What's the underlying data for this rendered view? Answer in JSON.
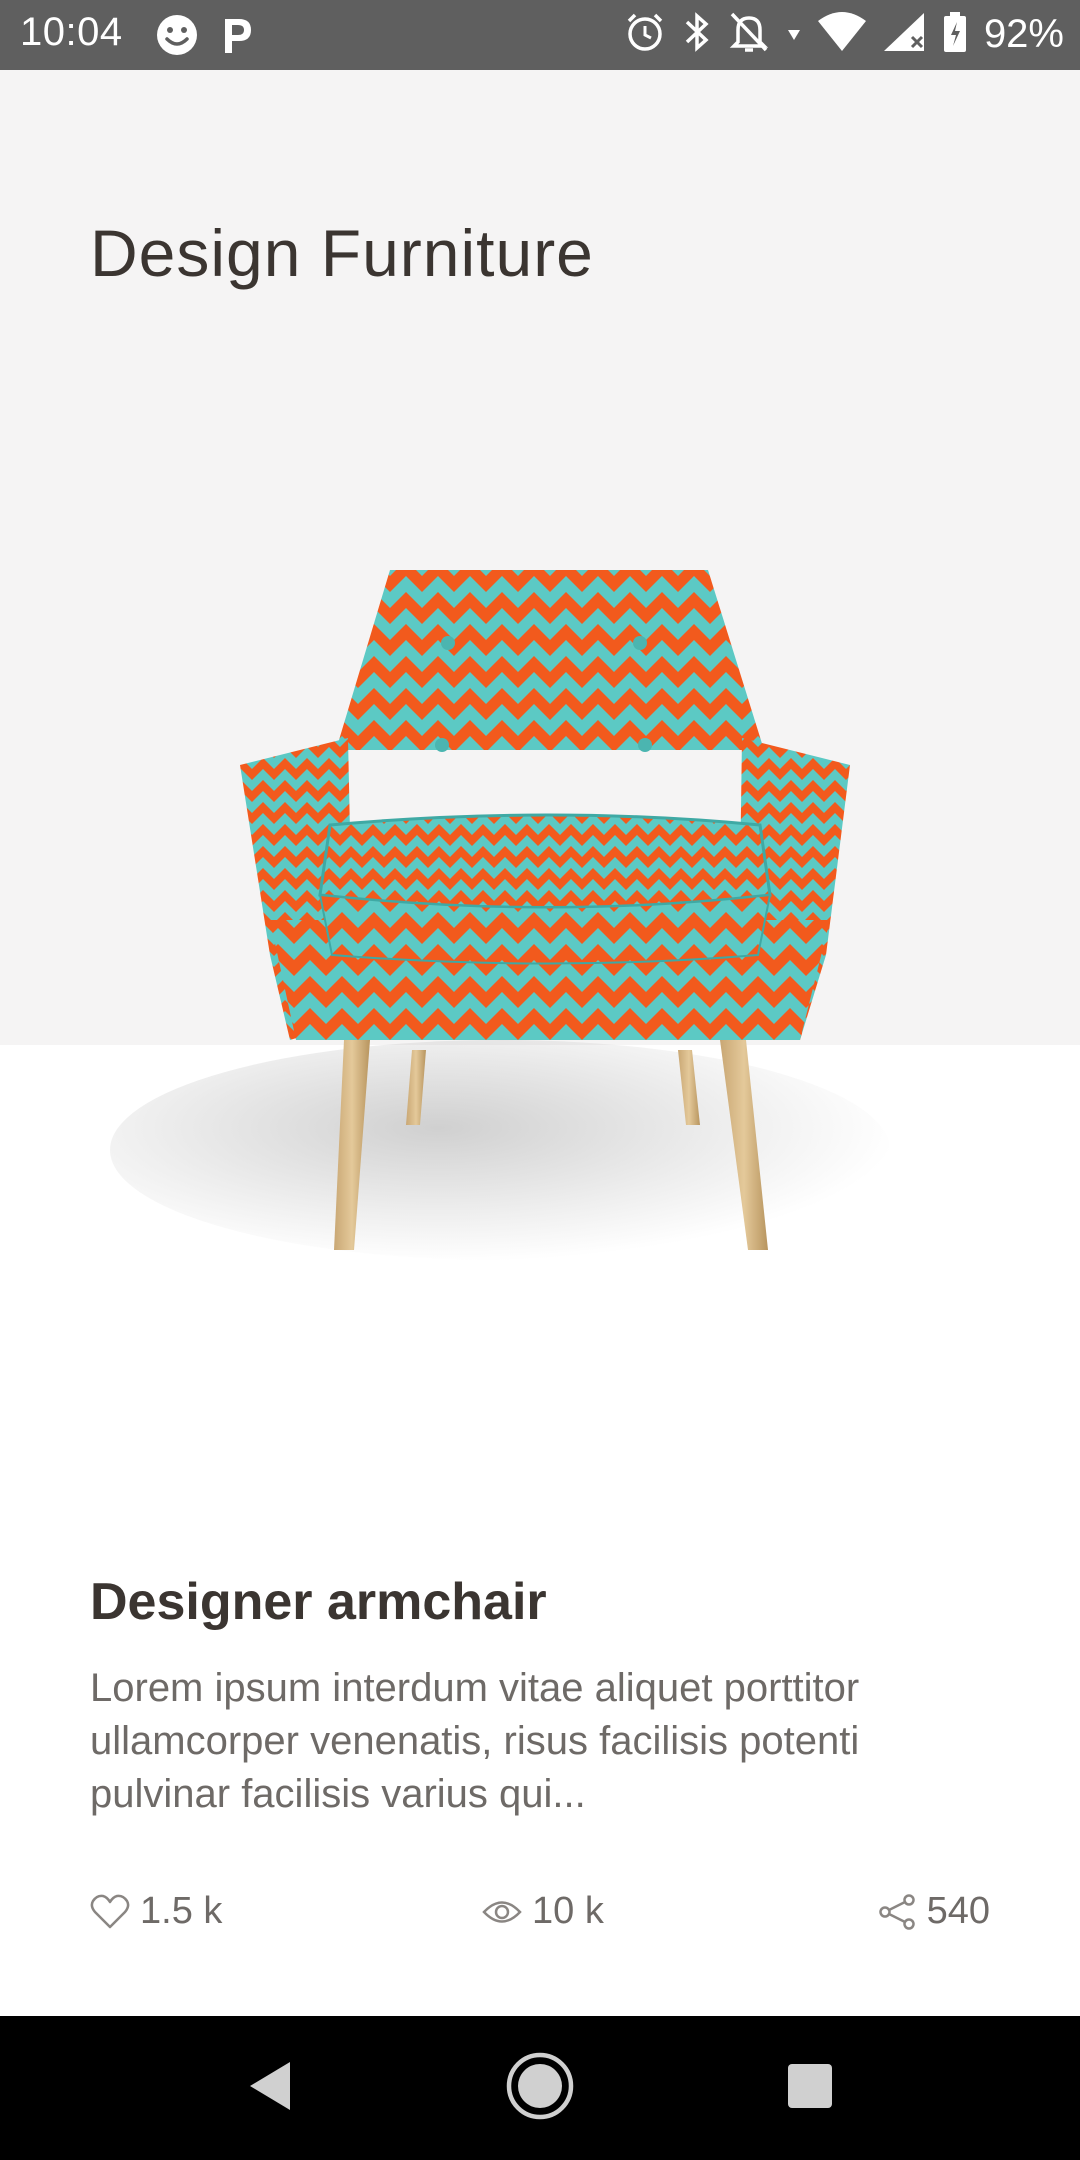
{
  "status_bar": {
    "time": "10:04",
    "battery": "92%",
    "icons": [
      "smiley-icon",
      "parking-icon",
      "alarm-icon",
      "bluetooth-icon",
      "muted-bell-icon",
      "data-arrows-icon",
      "wifi-icon",
      "signal-icon",
      "battery-icon"
    ]
  },
  "page": {
    "title": "Design Furniture"
  },
  "product": {
    "name": "Designer armchair",
    "description": "Lorem ipsum interdum vitae aliquet porttitor ullamcorper venenatis, risus facilisis potenti pulvinar facilisis varius qui...",
    "image_icon": "armchair-image",
    "colors": {
      "fabric_orange": "#f25a1d",
      "fabric_teal": "#5cc9c4",
      "legs": "#d8b98a"
    }
  },
  "stats": {
    "likes": "1.5 k",
    "views": "10 k",
    "shares": "540"
  },
  "nav_bar": {
    "back_icon": "back-triangle-icon",
    "home_icon": "home-circle-icon",
    "recents_icon": "recents-square-icon"
  }
}
